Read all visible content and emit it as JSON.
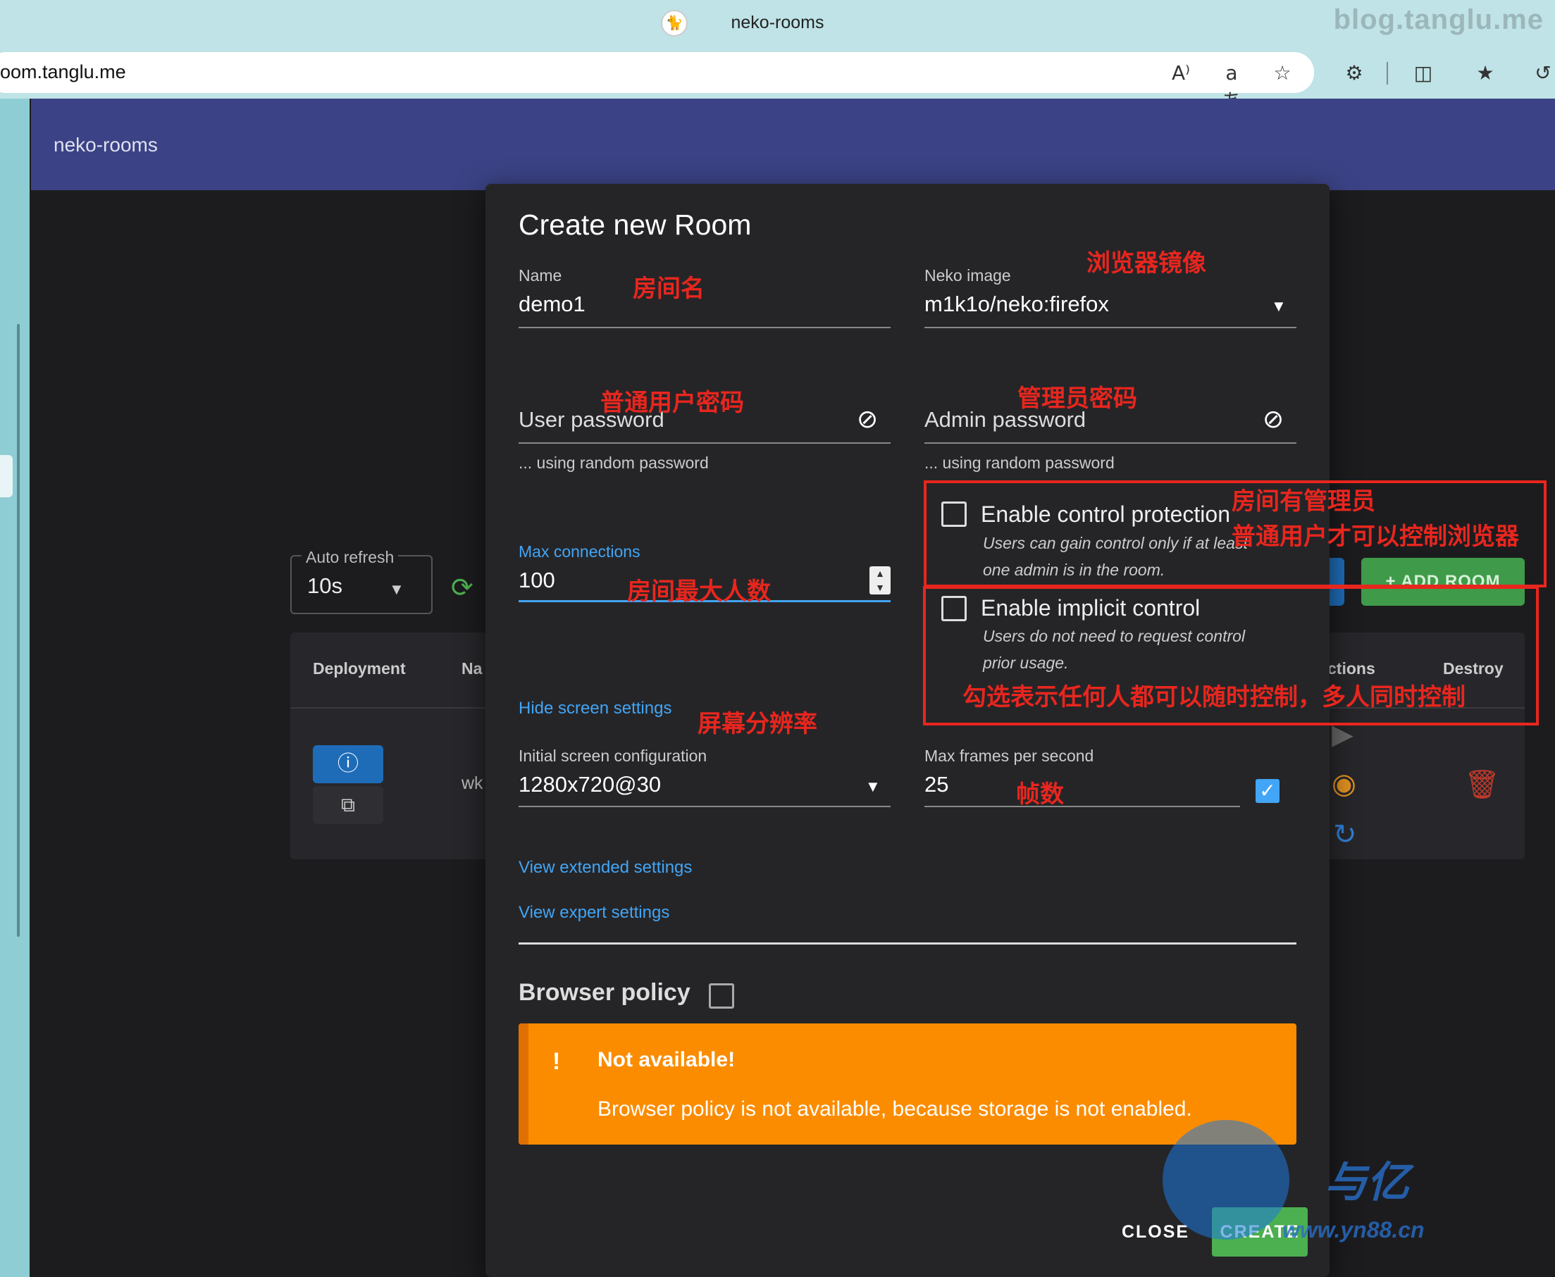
{
  "browser": {
    "tab_title": "neko-rooms",
    "url": "oom.tanglu.me",
    "watermark": "blog.tanglu.me",
    "icons": [
      "read-aloud-icon",
      "translate-icon",
      "favorite-add-icon",
      "extensions-icon",
      "split-screen-icon",
      "favorites-icon",
      "history-icon"
    ],
    "read_aloud_glyph": "A⁾",
    "translate_glyph": "aあ"
  },
  "app": {
    "title": "neko-rooms"
  },
  "background_page": {
    "auto_refresh_label": "Auto refresh",
    "auto_refresh_value": "10s",
    "table_headers": {
      "deployment": "Deployment",
      "name": "Na",
      "actions": "ctions",
      "destroy": "Destroy"
    },
    "row_name": "wk",
    "add_room_label": "+ ADD ROOM"
  },
  "dialog": {
    "title": "Create new Room",
    "name_label": "Name",
    "name_value": "demo1",
    "neko_image_label": "Neko image",
    "neko_image_value": "m1k1o/neko:firefox",
    "user_password_placeholder": "User password",
    "user_password_hint": "... using random password",
    "admin_password_placeholder": "Admin password",
    "admin_password_hint": "... using random password",
    "max_connections_label": "Max connections",
    "max_connections_value": "100",
    "control_protection_label": "Enable control protection",
    "control_protection_desc_1": "Users can gain control only if at least",
    "control_protection_desc_2": "one admin is in the room.",
    "implicit_control_label": "Enable implicit control",
    "implicit_control_desc_1": "Users do not need to request control",
    "implicit_control_desc_2": "prior usage.",
    "hide_screen_settings": "Hide screen settings",
    "screen_config_label": "Initial screen configuration",
    "screen_config_value": "1280x720@30",
    "max_fps_label": "Max frames per second",
    "max_fps_value": "25",
    "view_extended": "View extended settings",
    "view_expert": "View expert settings",
    "browser_policy_label": "Browser policy",
    "alert_title": "Not available!",
    "alert_message": "Browser policy is not available, because storage is not enabled.",
    "alert_icon": "!",
    "close_label": "CLOSE",
    "create_label": "CREATE"
  },
  "annotations": {
    "room_name": "房间名",
    "browser_image": "浏览器镜像",
    "user_password": "普通用户密码",
    "admin_password": "管理员密码",
    "control_protection_1": "房间有管理员",
    "control_protection_2": "普通用户才可以控制浏览器",
    "max_people": "房间最大人数",
    "implicit_control": "勾选表示任何人都可以随时控制，多人同时控制",
    "resolution": "屏幕分辨率",
    "fps": "帧数"
  },
  "watermark": {
    "text": "与亿",
    "url": "www.yn88.cn"
  },
  "colors": {
    "accent_blue": "#42a5f5",
    "header": "#3b4386",
    "warning": "#fb8c00",
    "create": "#4caf50",
    "annotation_red": "#e8261e"
  }
}
